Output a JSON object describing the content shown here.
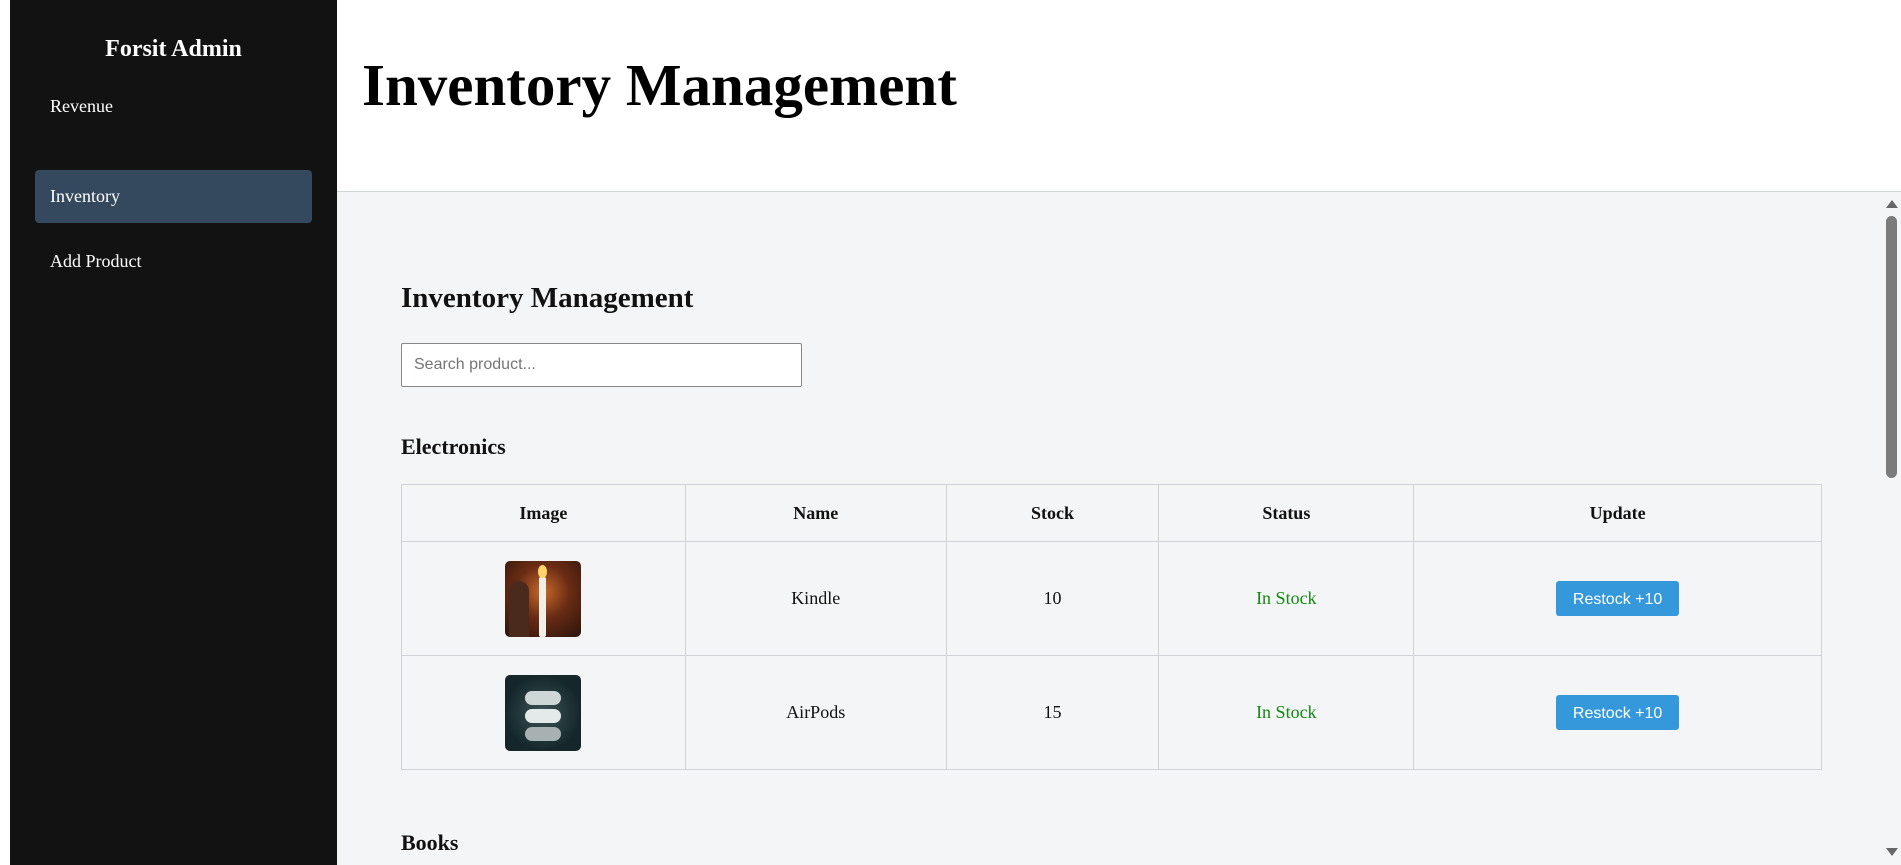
{
  "sidebar": {
    "brand": "Forsit Admin",
    "items": [
      {
        "label": "Revenue",
        "active": false
      },
      {
        "label": "Inventory",
        "active": true
      },
      {
        "label": "Add Product",
        "active": false
      }
    ]
  },
  "header": {
    "title": "Inventory Management"
  },
  "main": {
    "section_title": "Inventory Management",
    "search": {
      "placeholder": "Search product...",
      "value": ""
    },
    "categories": [
      {
        "name": "Electronics",
        "columns": [
          "Image",
          "Name",
          "Stock",
          "Status",
          "Update"
        ],
        "rows": [
          {
            "image": "candle-photo",
            "name": "Kindle",
            "stock": "10",
            "status": "In Stock",
            "action": "Restock +10"
          },
          {
            "image": "airpods-photo",
            "name": "AirPods",
            "stock": "15",
            "status": "In Stock",
            "action": "Restock +10"
          }
        ]
      },
      {
        "name": "Books"
      }
    ]
  },
  "colors": {
    "sidebar_bg": "#121212",
    "active_item_bg": "#34495e",
    "content_bg": "#f4f5f7",
    "status_green": "#138a13",
    "button_blue": "#3498db"
  }
}
